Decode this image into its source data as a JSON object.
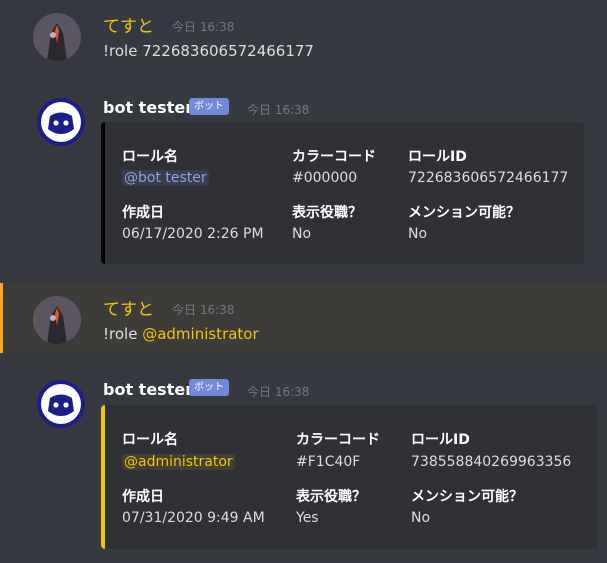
{
  "messages": [
    {
      "username": "てすと",
      "timestamp": "今日 16:38",
      "content": "!role 722683606572466177"
    },
    {
      "username": "bot tester",
      "badge": "ボット",
      "timestamp": "今日 16:38",
      "embed": {
        "color": "#000000",
        "fields": [
          {
            "name": "ロール名",
            "value": "@bot tester"
          },
          {
            "name": "カラーコード",
            "value": "#000000"
          },
          {
            "name": "ロールID",
            "value": "722683606572466177"
          },
          {
            "name": "作成日",
            "value": "06/17/2020 2:26 PM"
          },
          {
            "name": "表示役職？",
            "value": "No"
          },
          {
            "name": "メンション可能？",
            "value": "No"
          }
        ]
      }
    },
    {
      "username": "てすと",
      "timestamp": "今日 16:38",
      "content_prefix": "!role ",
      "content_mention": "@administrator"
    },
    {
      "username": "bot tester",
      "badge": "ボット",
      "timestamp": "今日 16:38",
      "embed": {
        "color": "#f1c40f",
        "fields": [
          {
            "name": "ロール名",
            "value": "@administrator"
          },
          {
            "name": "カラーコード",
            "value": "#F1C40F"
          },
          {
            "name": "ロールID",
            "value": "738558840269963356"
          },
          {
            "name": "作成日",
            "value": "07/31/2020 9:49 AM"
          },
          {
            "name": "表示役職？",
            "value": "Yes"
          },
          {
            "name": "メンション可能？",
            "value": "No"
          }
        ]
      }
    }
  ],
  "colors": {
    "background": "#36393f",
    "embed_bg": "#2f3136",
    "username_user": "#f1c40f",
    "badge": "#7289da",
    "highlight_border": "#faa61a"
  }
}
